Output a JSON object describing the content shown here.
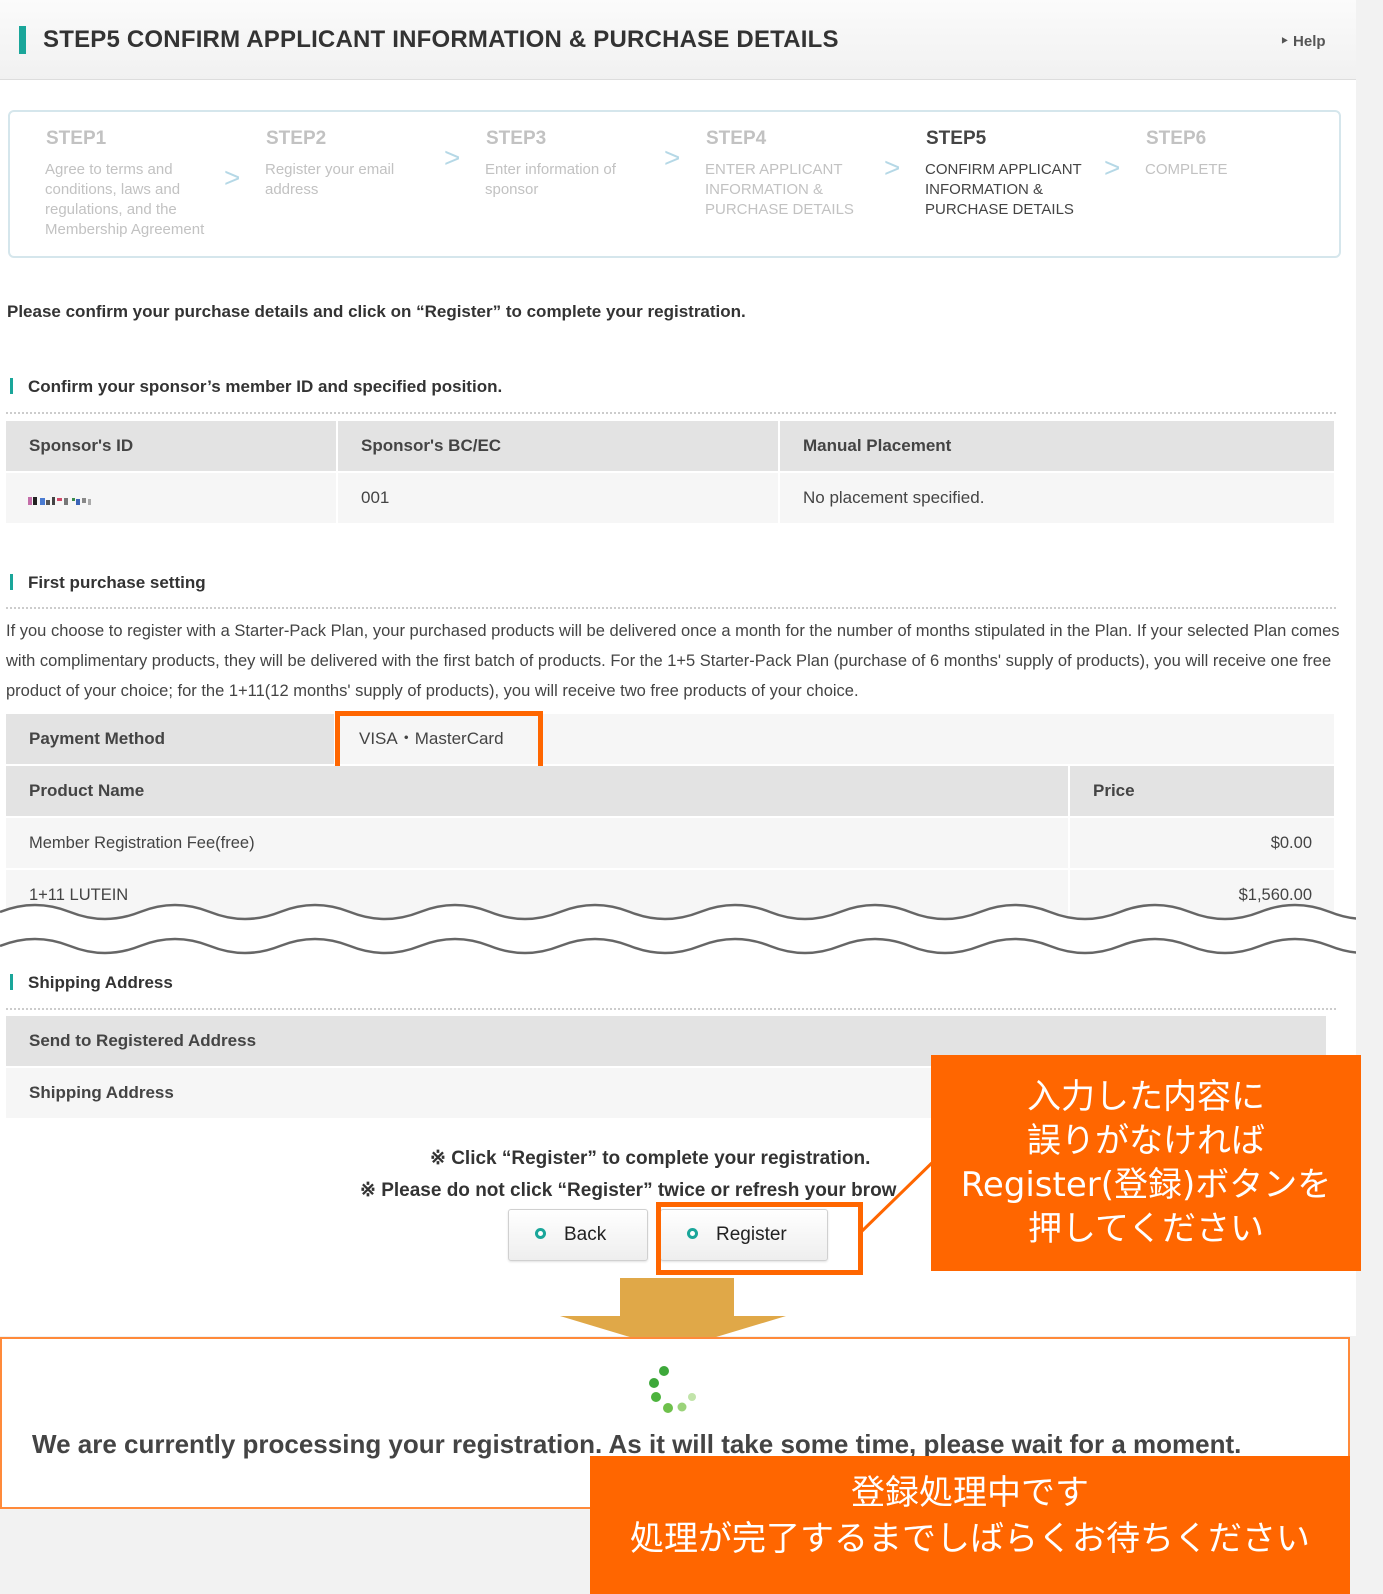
{
  "header": {
    "title": "STEP5 CONFIRM APPLICANT INFORMATION & PURCHASE DETAILS",
    "help": "‣ Help"
  },
  "steps": [
    {
      "num": "STEP1",
      "text": "Agree to terms and conditions, laws and regulations, and the Membership Agreement",
      "active": false
    },
    {
      "num": "STEP2",
      "text": "Register your email address",
      "active": false
    },
    {
      "num": "STEP3",
      "text": "Enter information of sponsor",
      "active": false
    },
    {
      "num": "STEP4",
      "text": "ENTER APPLICANT INFORMATION & PURCHASE DETAILS",
      "active": false
    },
    {
      "num": "STEP5",
      "text": "CONFIRM APPLICANT INFORMATION & PURCHASE DETAILS",
      "active": true
    },
    {
      "num": "STEP6",
      "text": "COMPLETE",
      "active": false
    }
  ],
  "intro": "Please confirm your purchase details and click on “Register” to complete your registration.",
  "sponsor": {
    "heading": "Confirm your sponsor’s member ID and specified position.",
    "headers": [
      "Sponsor's ID",
      "Sponsor's BC/EC",
      "Manual Placement"
    ],
    "bc_ec": "001",
    "placement": "No placement specified."
  },
  "purchase": {
    "heading": "First purchase setting",
    "description": "If you choose to register with a Starter-Pack Plan, your purchased products will be delivered once a month for the number of months stipulated in the Plan. If your selected Plan comes with complimentary products, they will be delivered with the first batch of products. For the 1+5 Starter-Pack Plan (purchase of 6 months' supply of products), you will receive one free product of your choice; for the 1+11(12 months' supply of products), you will receive two free products of your choice.",
    "payment_label": "Payment Method",
    "payment_value": "VISA・MasterCard",
    "product_header": "Product Name",
    "price_header": "Price",
    "rows": [
      {
        "name": "Member Registration Fee(free)",
        "price": "$0.00"
      },
      {
        "name": "1+11 LUTEIN",
        "price": "$1,560.00"
      }
    ]
  },
  "shipping": {
    "heading": "Shipping Address",
    "row1": "Send to Registered Address",
    "row2": "Shipping Address"
  },
  "notes": {
    "line1": "※ Click “Register” to complete your registration.",
    "line2": "※ Please do not click “Register” twice or refresh your brow"
  },
  "buttons": {
    "back": "Back",
    "register": "Register"
  },
  "callout1": {
    "lines": [
      "入力した内容に",
      "誤りがなければ",
      "Register(登録)ボタンを",
      "押してください"
    ]
  },
  "processing": {
    "message": "We are currently processing your registration. As it will take some time, please wait for a moment."
  },
  "callout2": {
    "lines": [
      "登録処理中です",
      "処理が完了するまでしばらくお待ちください"
    ]
  },
  "colors": {
    "accent": "#1aa69a",
    "highlight": "#ff6600",
    "arrow": "#e0a848"
  }
}
